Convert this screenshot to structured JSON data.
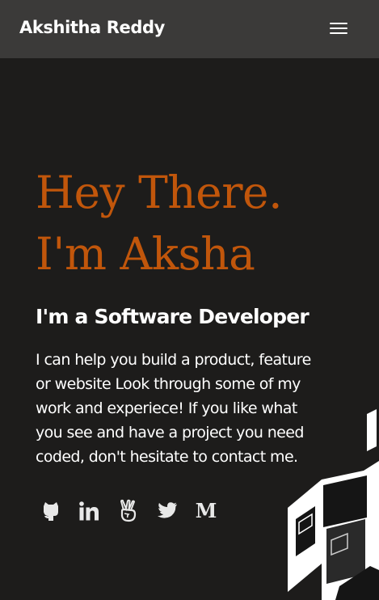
{
  "navbar": {
    "brand": "Akshitha Reddy",
    "menu_icon": "hamburger-menu-icon"
  },
  "hero": {
    "title_line1": "Hey There.",
    "title_line2": "I'm Aksha",
    "subtitle": "I'm a Software Developer",
    "bio_lines": [
      "I can help you build a product, feature",
      "or website Look through some of my",
      "work and experiece! If you like what",
      "you see and have a project you need",
      "coded, don't hesitate to contact me."
    ]
  },
  "socials": [
    {
      "name": "github",
      "icon": "github-icon"
    },
    {
      "name": "linkedin",
      "icon": "linkedin-icon"
    },
    {
      "name": "angellist",
      "icon": "angellist-icon"
    },
    {
      "name": "twitter",
      "icon": "twitter-icon"
    },
    {
      "name": "medium",
      "icon": "medium-icon"
    }
  ],
  "colors": {
    "background": "#1d1c1b",
    "navbar": "#3b3a39",
    "accent": "#c1560b",
    "text": "#ffffff",
    "icon": "#e8e8e8"
  }
}
